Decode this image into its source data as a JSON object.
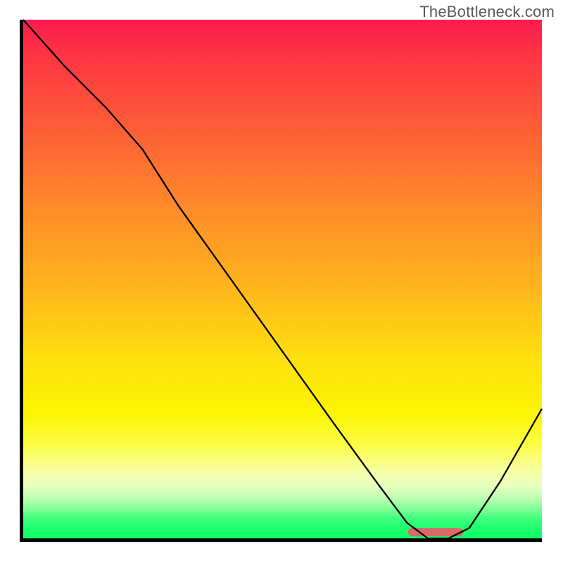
{
  "watermark": "TheBottleneck.com",
  "chart_data": {
    "type": "line",
    "title": "",
    "xlabel": "",
    "ylabel": "",
    "xlim": [
      0,
      100
    ],
    "ylim": [
      0,
      100
    ],
    "legend": false,
    "grid": false,
    "background": "vertical-gradient red→orange→yellow→green",
    "series": [
      {
        "name": "bottleneck-curve",
        "x": [
          0,
          8,
          16,
          23,
          30,
          40,
          50,
          60,
          68,
          74,
          78,
          82,
          86,
          92,
          100
        ],
        "y": [
          100,
          91,
          83,
          75,
          64,
          50,
          36,
          22,
          11,
          3,
          0,
          0,
          2,
          11,
          25
        ]
      }
    ],
    "annotations": [
      {
        "name": "optimal-segment",
        "type": "line-segment",
        "x0": 75,
        "y0": 1.2,
        "x1": 84,
        "y1": 1.2,
        "color": "#d96a6a"
      }
    ]
  }
}
